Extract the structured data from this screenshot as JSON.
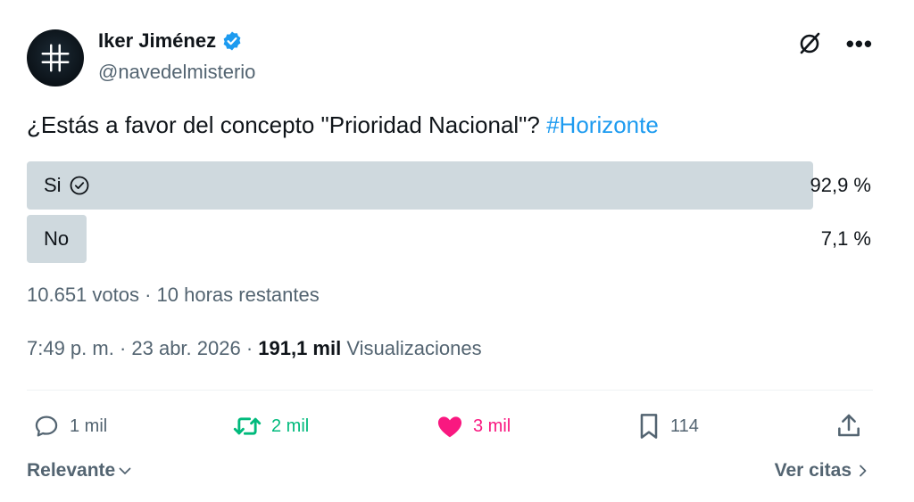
{
  "author": {
    "display_name": "Iker Jiménez",
    "handle": "@navedelmisterio",
    "verified_icon": "verified-badge-icon",
    "verified_color": "#1d9bf0"
  },
  "tweet": {
    "text": "¿Estás a favor del concepto \"Prioridad Nacional\"? ",
    "hashtag": "#Horizonte"
  },
  "poll": {
    "options": [
      {
        "label": "Si",
        "percent_text": "92,9 %",
        "percent": 92.9,
        "selected": true
      },
      {
        "label": "No",
        "percent_text": "7,1 %",
        "percent": 7.1,
        "selected": false
      }
    ],
    "meta": "10.651 votos · 10 horas restantes"
  },
  "meta": {
    "time_date": "7:49 p. m. · 23 abr. 2026 · ",
    "views_count": "191,1 mil",
    "views_label": " Visualizaciones"
  },
  "actions": {
    "reply": "1 mil",
    "retweet": "2 mil",
    "like": "3 mil",
    "bookmark": "114"
  },
  "footer": {
    "sort_label": "Relevante",
    "quotes_label": "Ver citas"
  },
  "colors": {
    "text": "#0f1419",
    "secondary": "#536471",
    "accent": "#1d9bf0",
    "retweet": "#00ba7c",
    "like": "#f91880",
    "poll_fill": "#cfd9de"
  }
}
